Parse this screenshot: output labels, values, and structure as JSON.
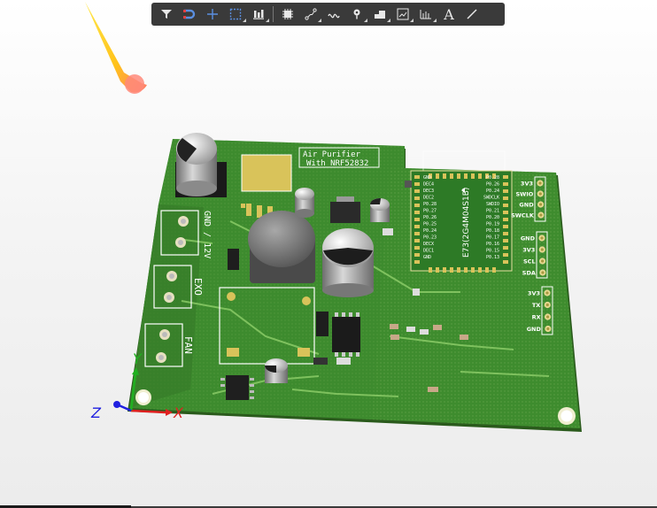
{
  "toolbar": {
    "tools": [
      {
        "icon": "filter-icon"
      },
      {
        "icon": "magnet-icon"
      },
      {
        "icon": "crosshair-icon"
      },
      {
        "icon": "selection-box-icon"
      },
      {
        "icon": "align-icon"
      },
      {
        "icon": "component-icon"
      },
      {
        "icon": "route-icon"
      },
      {
        "icon": "interactive-route-icon"
      },
      {
        "icon": "via-icon"
      },
      {
        "icon": "fill-icon"
      },
      {
        "icon": "graph-icon"
      },
      {
        "icon": "dimension-icon"
      },
      {
        "icon": "text-icon"
      },
      {
        "icon": "line-icon"
      }
    ],
    "text_tool_label": "A"
  },
  "board": {
    "title_line1": "Air Purifier",
    "title_line2": "With NRF52832",
    "connector_power": "GND / 12V",
    "connector_exo": "EXO",
    "connector_fan": "FAN",
    "module_name": "E73(2G4M04S1B)",
    "header_swd": [
      "3V3",
      "SWIO",
      "GND",
      "SWCLK"
    ],
    "header_i2c": [
      "GND",
      "3V3",
      "SCL",
      "SDA"
    ],
    "header_uart": [
      "3V3",
      "TX",
      "RX",
      "GND"
    ],
    "module_left_pins": [
      "GND",
      "DEC4",
      "DEC3",
      "DEC2",
      "P0.28",
      "P0.27",
      "P0.26",
      "P0.25",
      "P0.24",
      "P0.23",
      "DECX",
      "DEC1",
      "GND"
    ],
    "module_right_pins": [
      "P0.28",
      "P0.26",
      "P0.24",
      "SWDCLK",
      "SWDIO",
      "P0.21",
      "P0.20",
      "P0.19",
      "P0.18",
      "P0.17",
      "P0.16",
      "P0.15",
      "P0.13"
    ]
  },
  "axes": {
    "x": "X",
    "y": "Y",
    "z": "Z"
  },
  "colors": {
    "board": "#3d8a2e",
    "board_dark": "#2f6e22",
    "silkscreen": "#ffffff",
    "pad": "#d9c35a",
    "toolbar": "#3a3a3a",
    "axis_x": "#e02020",
    "axis_y": "#20b020",
    "axis_z": "#2020e0"
  }
}
